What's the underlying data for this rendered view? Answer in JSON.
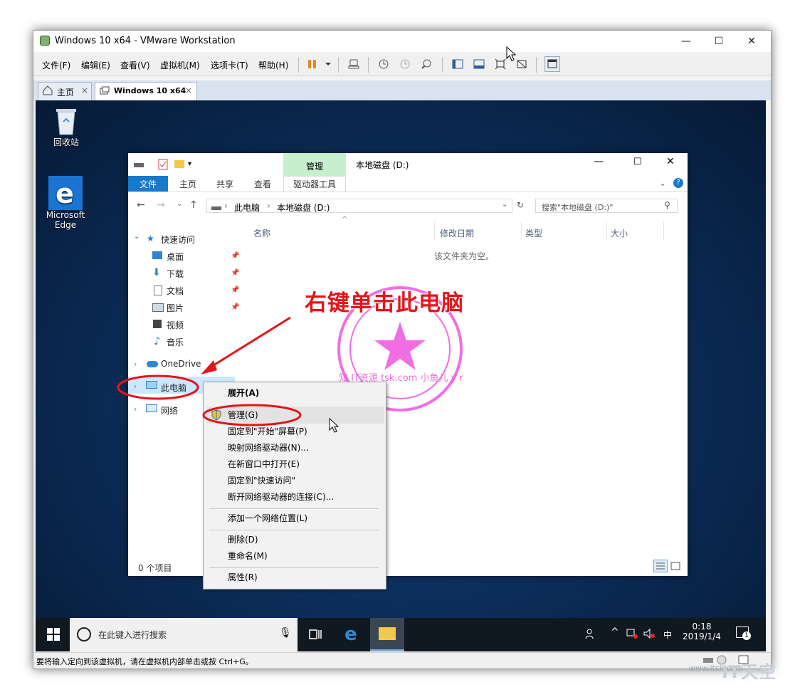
{
  "window": {
    "title": "Windows 10 x64 - VMware Workstation"
  },
  "menubar": {
    "items": [
      "文件(F)",
      "编辑(E)",
      "查看(V)",
      "虚拟机(M)",
      "选项卡(T)",
      "帮助(H)"
    ]
  },
  "tabs": [
    {
      "label": "主页",
      "close": "×"
    },
    {
      "label": "Windows 10 x64",
      "close": "×"
    }
  ],
  "statusbar": {
    "text": "要将输入定向到该虚拟机，请在虚拟机内部单击或按 Ctrl+G。"
  },
  "desktop": {
    "icons": [
      {
        "label": "回收站",
        "icon": "recycle-bin-icon"
      },
      {
        "label": "Microsoft Edge",
        "icon": "edge-icon"
      }
    ]
  },
  "explorer": {
    "context_tab": "管理",
    "title": "本地磁盘 (D:)",
    "ribbon_tabs": [
      "文件",
      "主页",
      "共享",
      "查看",
      "驱动器工具"
    ],
    "address": {
      "path": [
        "此电脑",
        "本地磁盘 (D:)"
      ]
    },
    "search": {
      "placeholder": "搜索\"本地磁盘 (D:)\""
    },
    "nav": {
      "quick_access": "快速访问",
      "quick_items": [
        "桌面",
        "下载",
        "文档",
        "图片",
        "视频",
        "音乐"
      ],
      "onedrive": "OneDrive",
      "this_pc": "此电脑",
      "network": "网络"
    },
    "columns": [
      "名称",
      "修改日期",
      "类型",
      "大小"
    ],
    "empty_text": "该文件夹为空。",
    "item_count": "0 个项目"
  },
  "context_menu": {
    "items": [
      {
        "label": "展开(A)",
        "bold": true
      },
      {
        "label": "管理(G)",
        "icon": "shield-icon"
      },
      {
        "label": "固定到\"开始\"屏幕(P)"
      },
      {
        "label": "映射网络驱动器(N)..."
      },
      {
        "label": "在新窗口中打开(E)"
      },
      {
        "label": "固定到\"快速访问\""
      },
      {
        "label": "断开网络驱动器的连接(C)..."
      },
      {
        "label": "添加一个网络位置(L)"
      },
      {
        "label": "删除(D)"
      },
      {
        "label": "重命名(M)"
      },
      {
        "label": "属性(R)"
      }
    ]
  },
  "taskbar": {
    "search_placeholder": "在此键入进行搜索",
    "clock_time": "0:18",
    "clock_date": "2019/1/4",
    "ime": "中",
    "notification_count": "1"
  },
  "annotation": {
    "text": "右键单击此电脑",
    "color": "#e4141b",
    "stamp_text": "知 IT资源 tsk.com 小鱼儿 y r"
  },
  "watermark": {
    "site": "www.itsk.com",
    "logo": "IT天空"
  },
  "colors": {
    "accent": "#1979ca",
    "manage_tab": "#c6efce",
    "stamp": "#ee55dd"
  }
}
